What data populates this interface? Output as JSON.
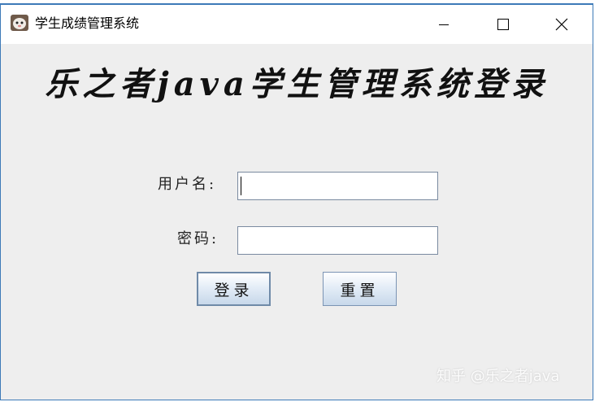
{
  "window": {
    "title": "学生成绩管理系统",
    "controls": {
      "minimize": "—",
      "close": "✕"
    }
  },
  "login": {
    "heading": "乐之者java学生管理系统登录",
    "username_label": "用户名:",
    "password_label": "密码:",
    "username_value": "",
    "password_value": "",
    "login_button": "登录",
    "reset_button": "重置"
  },
  "watermark": "知乎 @乐之者java",
  "colors": {
    "window_border": "#3d7ab8",
    "content_bg": "#eeeeee",
    "button_border": "#7b94b4"
  }
}
